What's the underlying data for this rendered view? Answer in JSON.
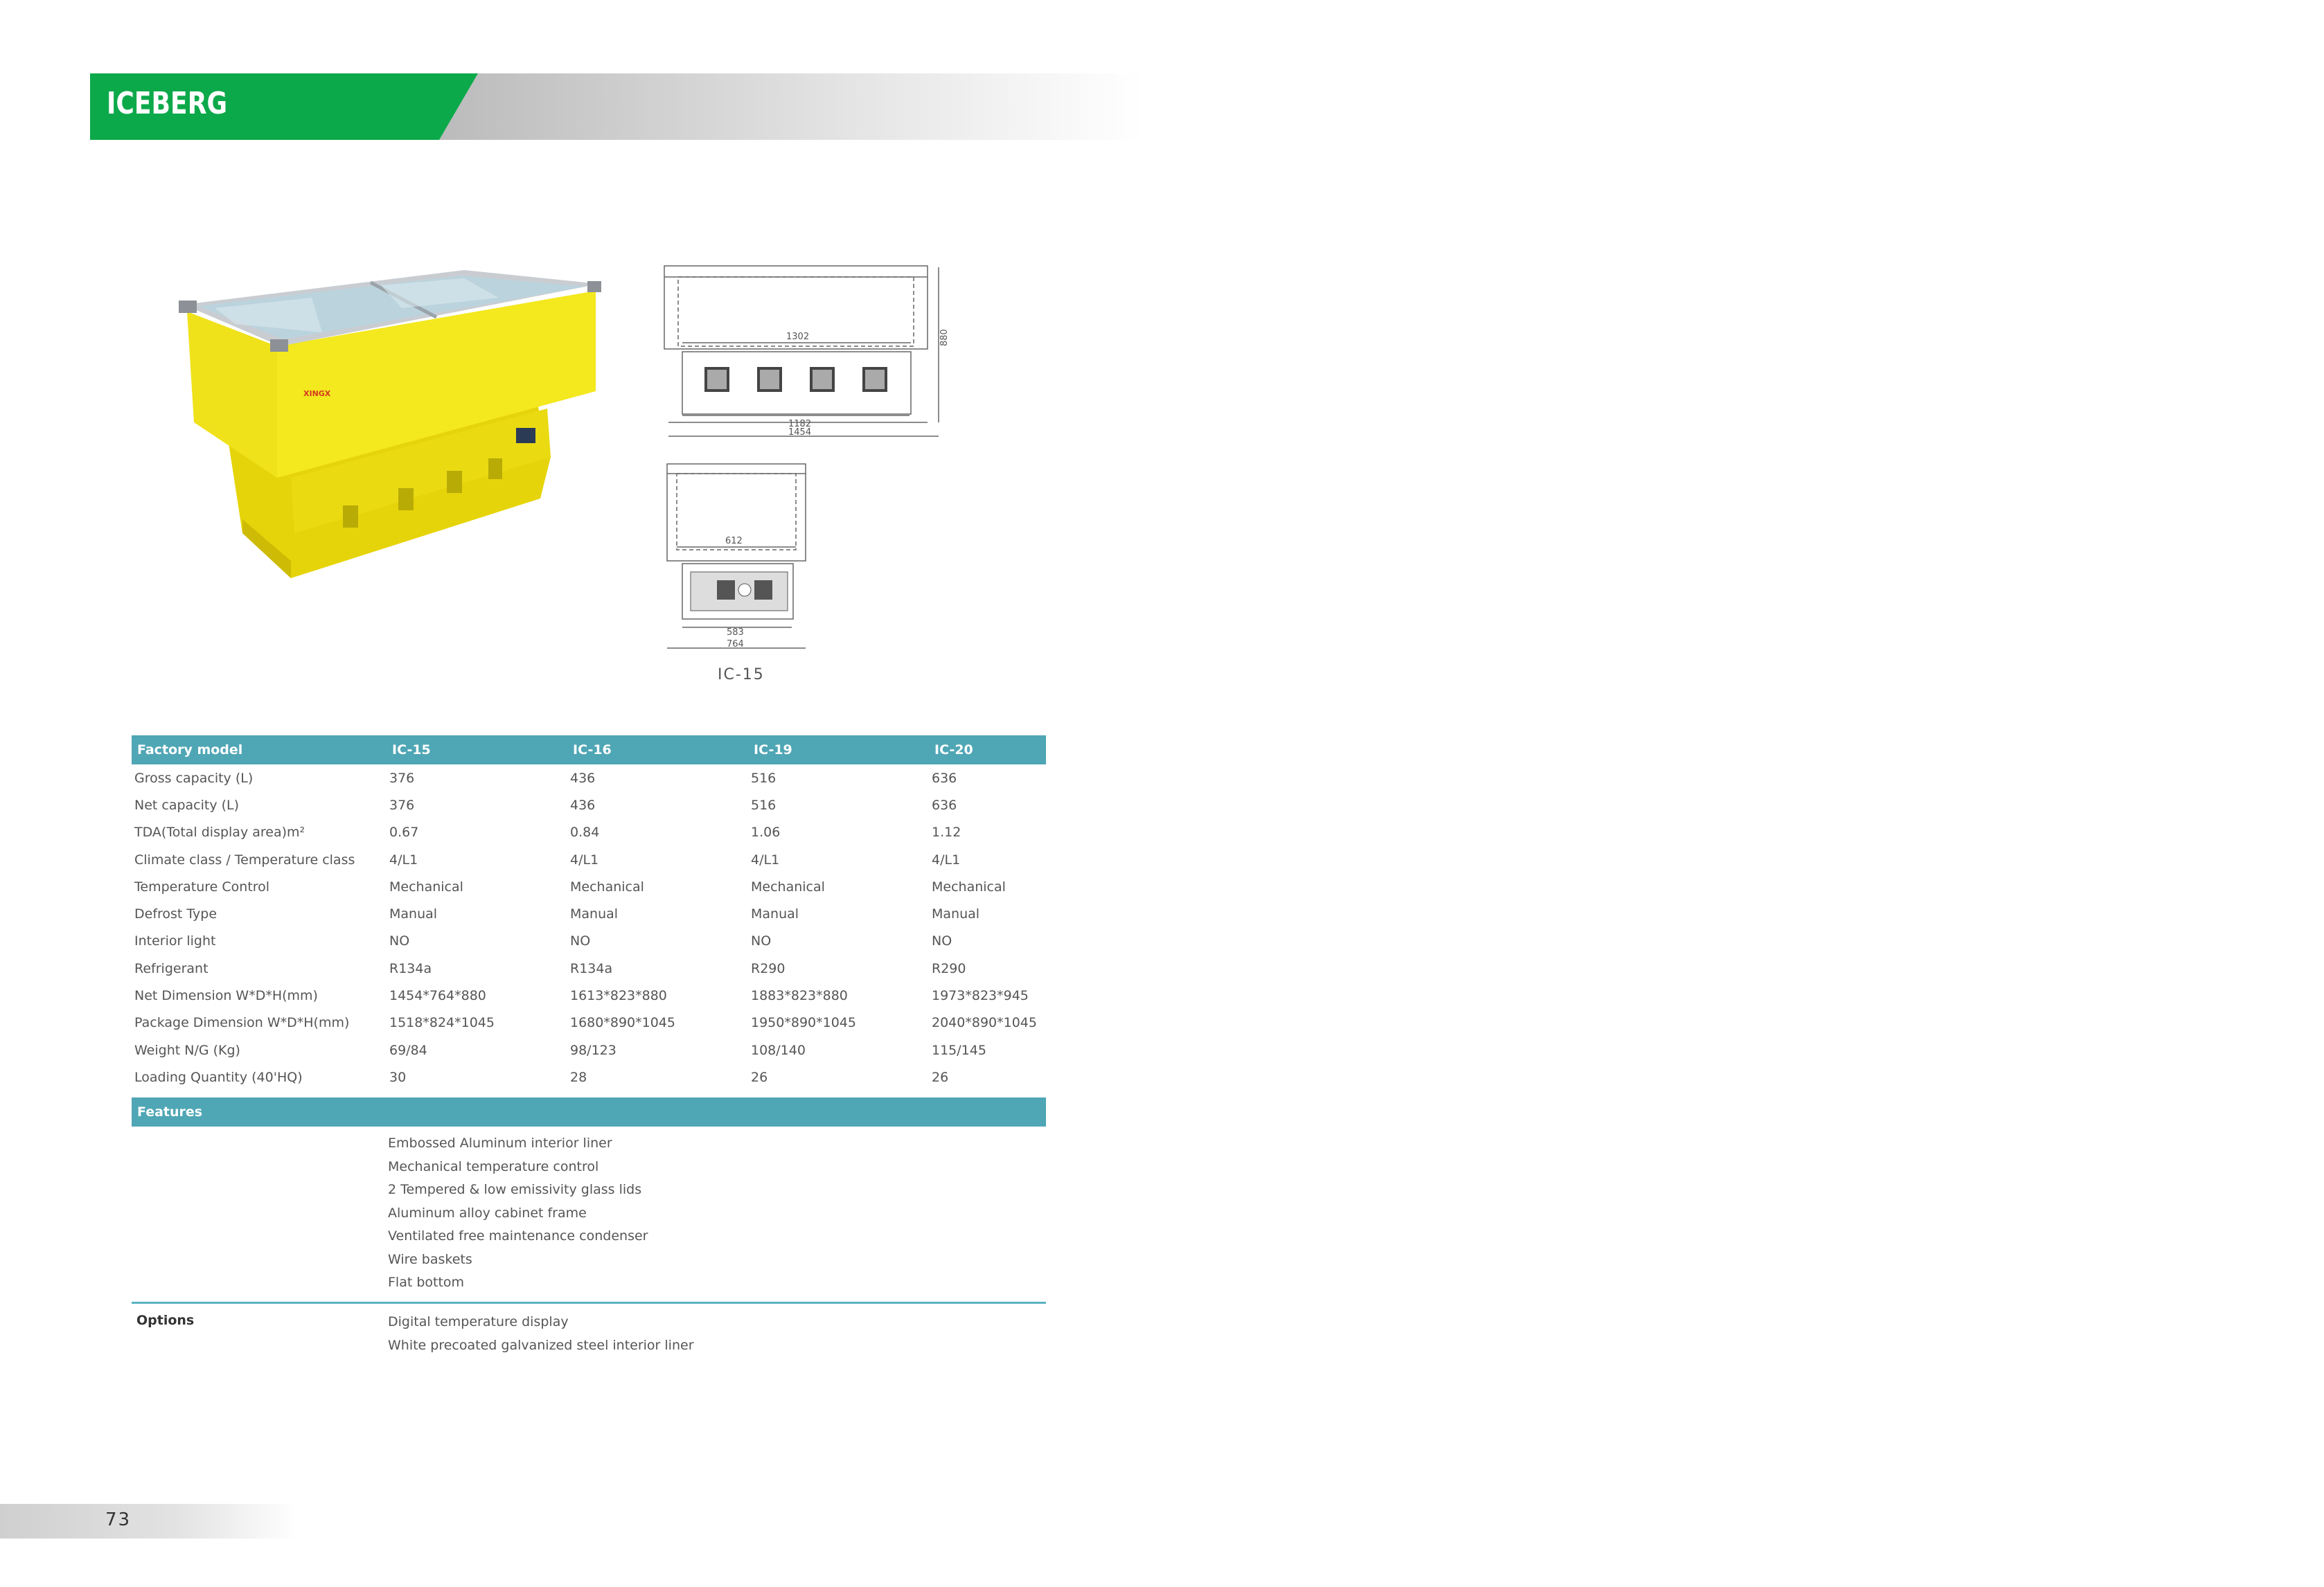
{
  "brand": {
    "title": "ICEBERG",
    "accent_color": "#0ca94a"
  },
  "drawing": {
    "caption": "IC-15",
    "front_dims": {
      "inner_width": "1302",
      "height": "880",
      "base_width": "1182",
      "total_width": "1454"
    },
    "side_dims": {
      "inner_width": "612",
      "base_width": "583",
      "total_width": "764"
    }
  },
  "product_image": {
    "badge": "XINGX"
  },
  "table": {
    "header": [
      "Factory model",
      "IC-15",
      "IC-16",
      "IC-19",
      "IC-20"
    ],
    "rows": [
      [
        "Gross capacity (L)",
        "376",
        "436",
        "516",
        "636"
      ],
      [
        "Net capacity (L)",
        "376",
        "436",
        "516",
        "636"
      ],
      [
        "TDA(Total display area)m²",
        "0.67",
        "0.84",
        "1.06",
        "1.12"
      ],
      [
        "Climate class / Temperature class",
        "4/L1",
        "4/L1",
        "4/L1",
        "4/L1"
      ],
      [
        "Temperature Control",
        "Mechanical",
        "Mechanical",
        "Mechanical",
        "Mechanical"
      ],
      [
        "Defrost Type",
        "Manual",
        "Manual",
        "Manual",
        "Manual"
      ],
      [
        "Interior light",
        "NO",
        "NO",
        "NO",
        "NO"
      ],
      [
        "Refrigerant",
        "R134a",
        "R134a",
        "R290",
        "R290"
      ],
      [
        "Net Dimension W*D*H(mm)",
        "1454*764*880",
        "1613*823*880",
        "1883*823*880",
        "1973*823*945"
      ],
      [
        "Package Dimension W*D*H(mm)",
        "1518*824*1045",
        "1680*890*1045",
        "1950*890*1045",
        "2040*890*1045"
      ],
      [
        "Weight N/G (Kg)",
        "69/84",
        "98/123",
        "108/140",
        "115/145"
      ],
      [
        "Loading Quantity (40'HQ)",
        "30",
        "28",
        "26",
        "26"
      ]
    ]
  },
  "features": {
    "label": "Features",
    "items": [
      "Embossed Aluminum interior liner",
      "Mechanical temperature control",
      "2 Tempered & low emissivity glass lids",
      "Aluminum alloy cabinet frame",
      "Ventilated free maintenance condenser",
      "Wire baskets",
      "Flat bottom"
    ]
  },
  "options": {
    "label": "Options",
    "items": [
      "Digital temperature display",
      "White precoated galvanized steel interior liner"
    ]
  },
  "footer": {
    "page_number": "73"
  }
}
